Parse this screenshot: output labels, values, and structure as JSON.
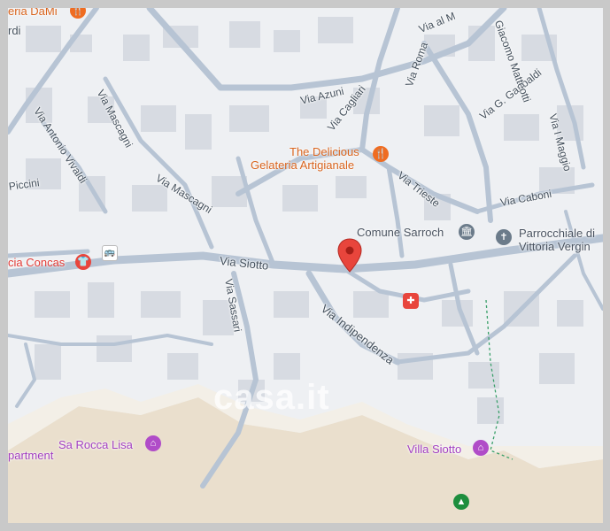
{
  "streets": {
    "via_al": "Via al M",
    "via_azuni": "Via Azuni",
    "via_cagliari": "Via Cagliari",
    "via_roma": "Via Roma",
    "via_garibaldi": "Via G. Garibaldi",
    "via_matteotti": "Giacomo Matteotti",
    "via_maggio": "Via I Maggio",
    "via_vivaldi": "Via Antonio Vivaldi",
    "via_mascagni_vert": "Via Mascagni",
    "via_mascagni": "Via Mascagni",
    "via_piccini": "Piccini",
    "via_trieste": "Via Trieste",
    "via_caboni": "Via Caboni",
    "via_siotto": "Via Siotto",
    "via_sassari": "Via Sassari",
    "via_indipendenza": "Via Indipendenza",
    "top_left": "rdi"
  },
  "pois": {
    "gelateria_dami": "eria DaMi",
    "delicious_line1": "The Delicious",
    "delicious_line2": "Gelateria Artigianale",
    "comune": "Comune Sarroch",
    "parrocchiale_line1": "Parrocchiale di",
    "parrocchiale_line2": "Vittoria Vergin",
    "farmacia": "cia Concas",
    "sa_rocca": "Sa Rocca Lisa",
    "apartment": "partment",
    "villa_siotto": "Villa Siotto"
  },
  "watermark": "casa.it",
  "colors": {
    "land": "#eef0f3",
    "road": "#b7c4d4",
    "building": "#d7dbe2",
    "sand": "#eadfcd",
    "orange": "#ef6c21",
    "red_pin": "#e8453c",
    "purple": "#b04cc8",
    "green": "#1e8e3e",
    "gray_icon": "#6b7b8a"
  },
  "icons": [
    "location-pin-icon",
    "restaurant-icon",
    "government-icon",
    "church-icon",
    "shopping-icon",
    "bus-stop-icon",
    "hospital-icon",
    "lodging-icon",
    "park-icon"
  ]
}
